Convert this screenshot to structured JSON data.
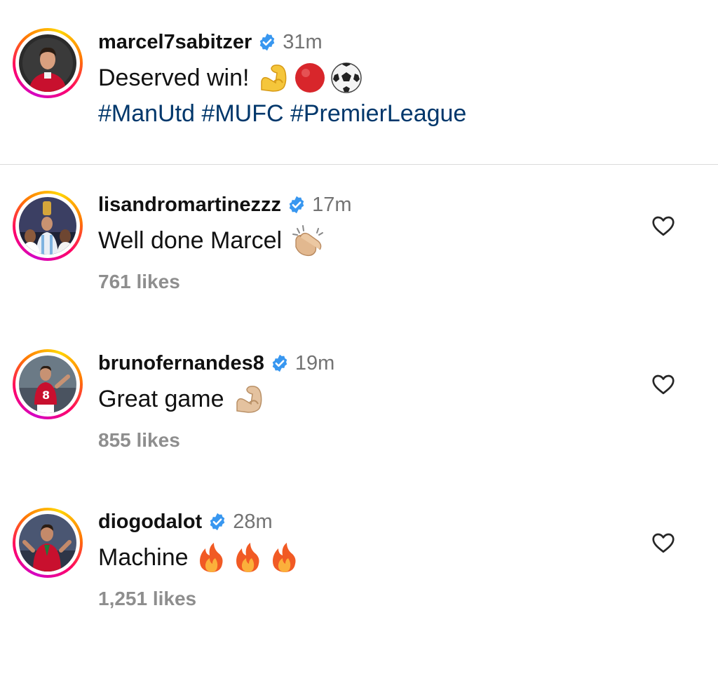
{
  "post": {
    "username": "marcel7sabitzer",
    "time": "31m",
    "caption": "Deserved win!",
    "caption_emojis": [
      "flexed-biceps",
      "red-circle",
      "soccer-ball"
    ],
    "hashtags": "#ManUtd #MUFC #PremierLeague"
  },
  "comments": [
    {
      "username": "lisandromartinezzz",
      "time": "17m",
      "text": "Well done Marcel",
      "emoji": "clapping-hands",
      "likes": "761 likes"
    },
    {
      "username": "brunofernandes8",
      "time": "19m",
      "text": "Great game",
      "emoji": "flexed-biceps",
      "likes": "855 likes"
    },
    {
      "username": "diogodalot",
      "time": "28m",
      "text": "Machine",
      "emoji": "fire x3",
      "likes": "1,251 likes"
    }
  ],
  "colors": {
    "hashtag": "#00376b",
    "verified": "#3897f0",
    "muted": "#737373",
    "likes": "#8e8e8e",
    "divider": "#dbdbdb"
  },
  "icons": [
    "verified-badge-icon",
    "heart-outline-icon"
  ]
}
